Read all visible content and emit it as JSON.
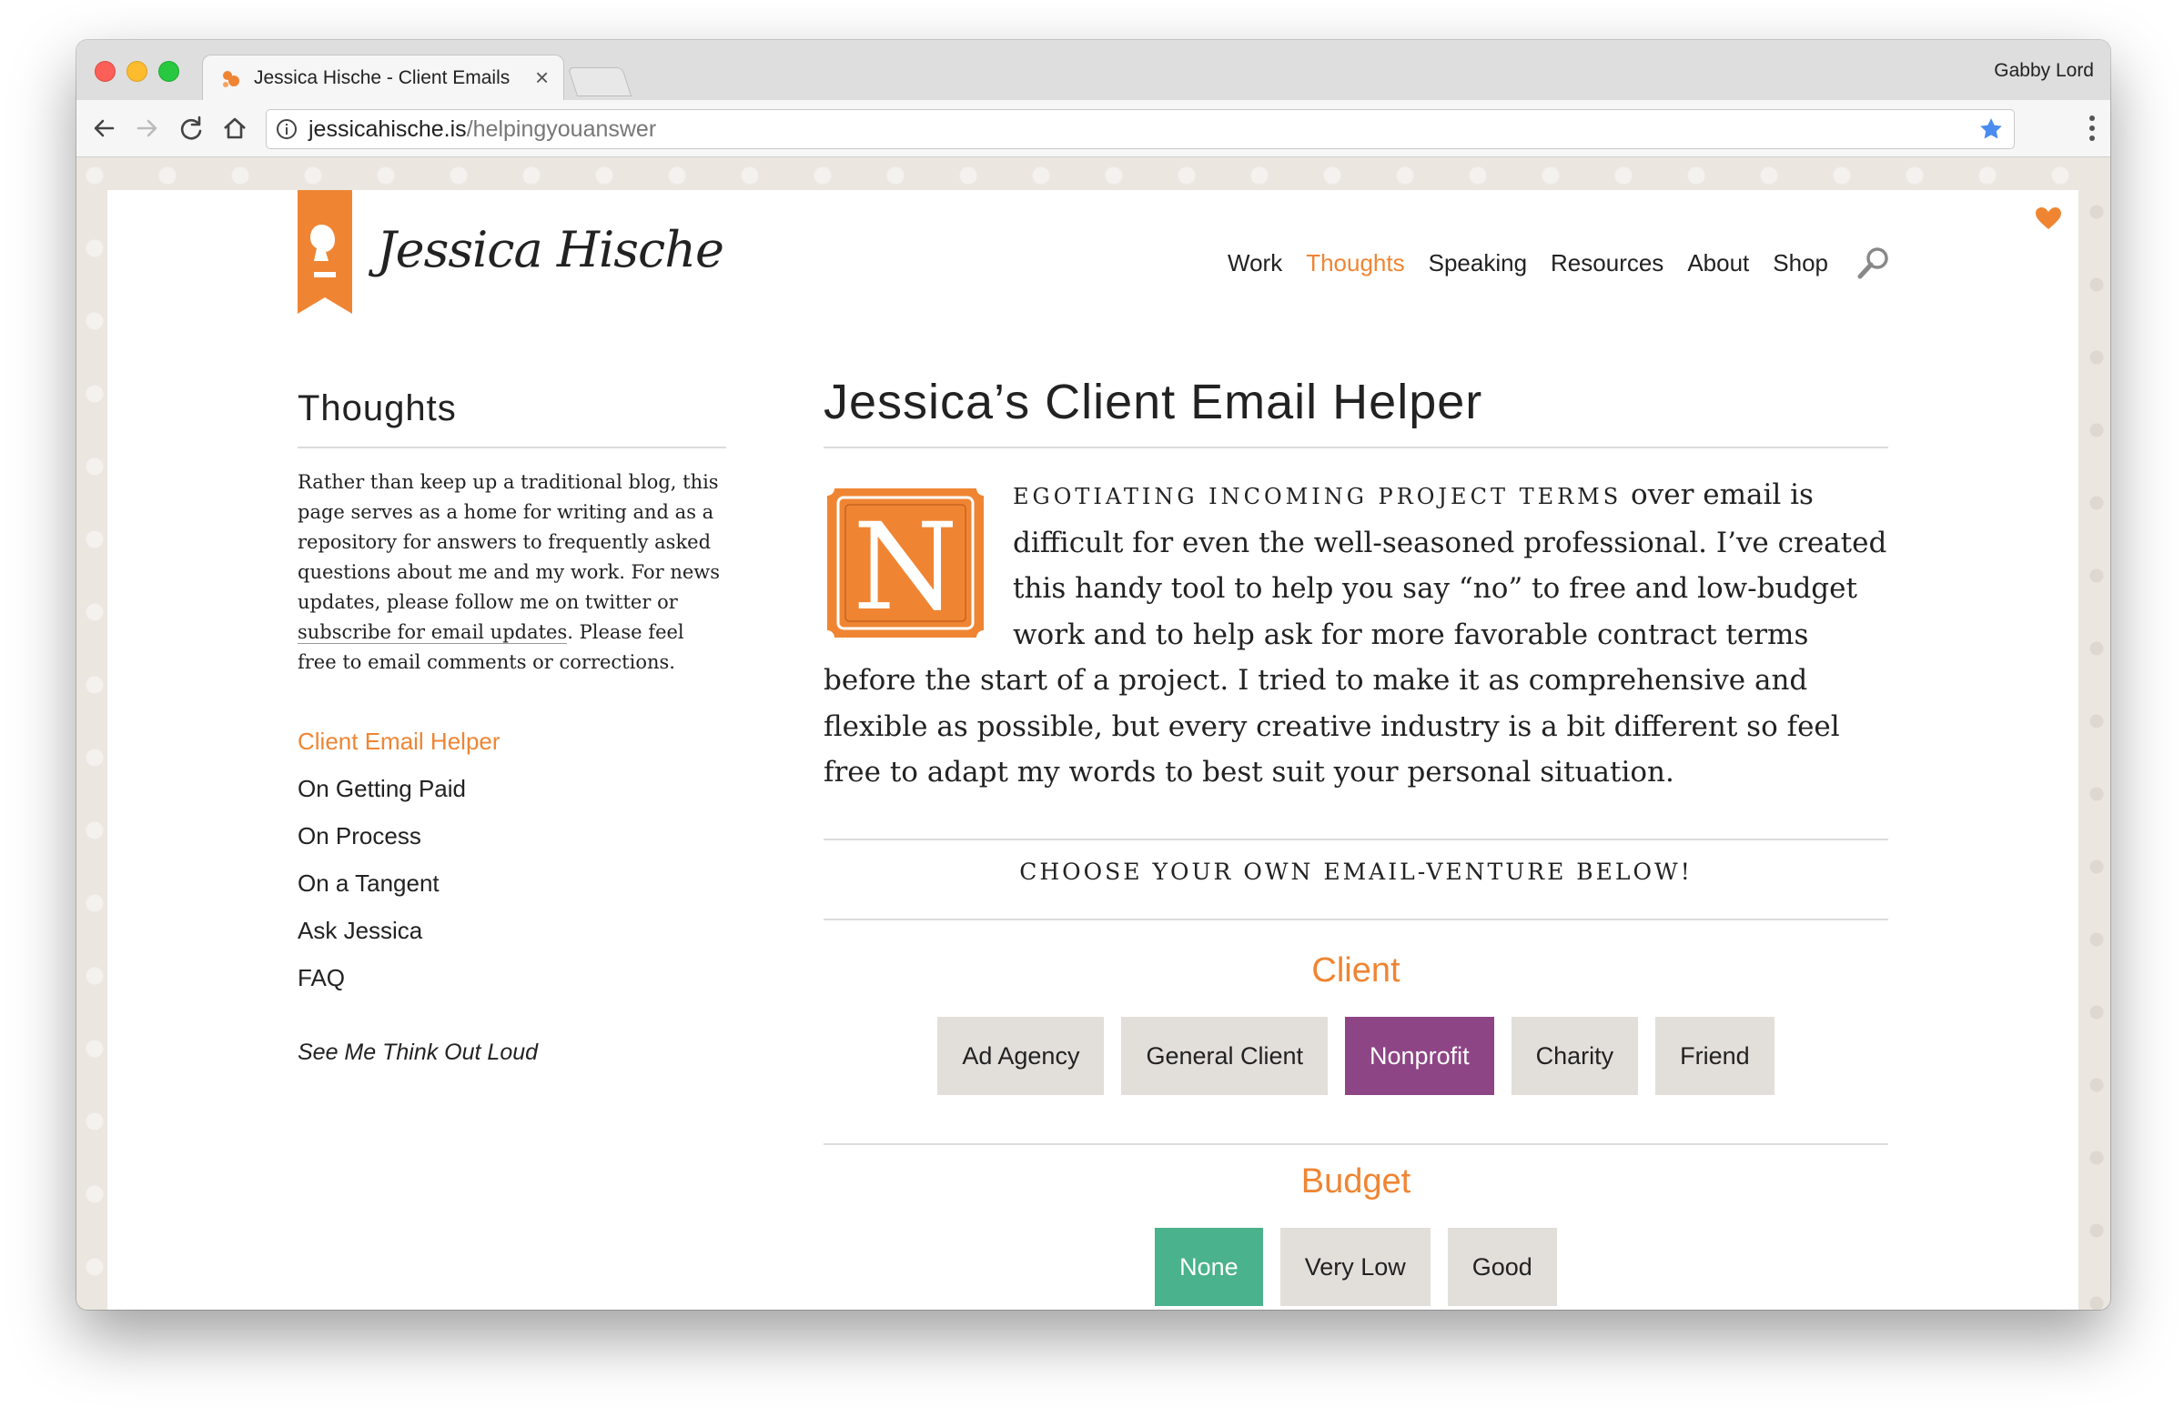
{
  "browser": {
    "tab_title": "Jessica Hische - Client Emails",
    "profile_name": "Gabby Lord",
    "url_host": "jessicahische.is",
    "url_path": "/helpingyouanswer"
  },
  "header": {
    "logo_text": "Jessica Hische",
    "nav": [
      "Work",
      "Thoughts",
      "Speaking",
      "Resources",
      "About",
      "Shop"
    ],
    "active_nav": "Thoughts"
  },
  "sidebar": {
    "title": "Thoughts",
    "description_start": "Rather than keep up a traditional blog, this page serves as a home for writing and as a repository for answers to frequently asked questions about me and my work. For news updates, please follow me on twitter or ",
    "description_link": "subscribe for email updates",
    "description_end": ". Please feel free to email comments or corrections.",
    "links": [
      "Client Email Helper",
      "On Getting Paid",
      "On Process",
      "On a Tangent",
      "Ask Jessica",
      "FAQ"
    ],
    "active_link": "Client Email Helper",
    "footer_link": "See Me Think Out Loud"
  },
  "main": {
    "title": "Jessica’s Client Email Helper",
    "dropcap": "N",
    "intro_smallcaps": "egotiating incoming project terms",
    "intro_rest": " over email is difficult for even the well-seasoned professional. I’ve created this handy tool to help you say “no” to free and low-budget work and to help ask for more favorable contract terms before the start of a project. I tried to make it as comprehensive and flexible as possible, but every creative industry is a bit different so feel free to adapt my words to best suit your personal situation.",
    "choose_text": "Choose Your Own Email-venture Below!",
    "client_label": "Client",
    "client_options": [
      "Ad Agency",
      "General Client",
      "Nonprofit",
      "Charity",
      "Friend"
    ],
    "client_selected": "Nonprofit",
    "budget_label": "Budget",
    "budget_options": [
      "None",
      "Very Low",
      "Good"
    ],
    "budget_selected": "None"
  },
  "colors": {
    "accent_orange": "#ef8533",
    "selected_purple": "#8e4585",
    "selected_green": "#4ab28d",
    "button_gray": "#e2dfda"
  }
}
